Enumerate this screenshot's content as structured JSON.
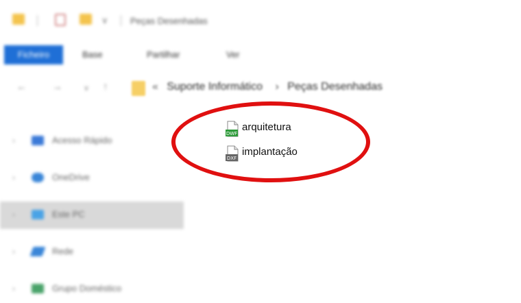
{
  "window": {
    "title": "Peças Desenhadas",
    "dropdown_glyph": "∨"
  },
  "ribbon": {
    "tabs": [
      "Ficheiro",
      "Base",
      "Partilhar",
      "Ver"
    ],
    "active_color": "#1f6fd6"
  },
  "address": {
    "sep_glyph": "«",
    "crumbs": [
      "Suporte Informático",
      "Peças Desenhadas"
    ],
    "chevron": "›"
  },
  "nav": {
    "back_icon": "←",
    "forward_icon": "→",
    "recent_icon": "∨",
    "up_icon": "↑"
  },
  "sidebar": {
    "expand_glyph": "›",
    "items": [
      {
        "label": "Acesso Rápido",
        "icon": "star-icon",
        "color": "#3b7ad8"
      },
      {
        "label": "OneDrive",
        "icon": "cloud-icon",
        "color": "#3a86d8"
      },
      {
        "label": "Este PC",
        "icon": "computer-icon",
        "color": "#4aa3e6",
        "selected": true
      },
      {
        "label": "Rede",
        "icon": "network-icon",
        "color": "#3a86d8"
      },
      {
        "label": "Grupo Doméstico",
        "icon": "homegroup-icon",
        "color": "#4aa36a"
      }
    ]
  },
  "files": [
    {
      "name": "arquitetura",
      "type": "DWF",
      "icon": "dwf-file-icon",
      "badge_color": "#2e9a3a"
    },
    {
      "name": "implantação",
      "type": "DXF",
      "icon": "dxf-file-icon",
      "badge_color": "#666666"
    }
  ],
  "annotation": {
    "color": "#e01010",
    "shape": "ellipse"
  }
}
